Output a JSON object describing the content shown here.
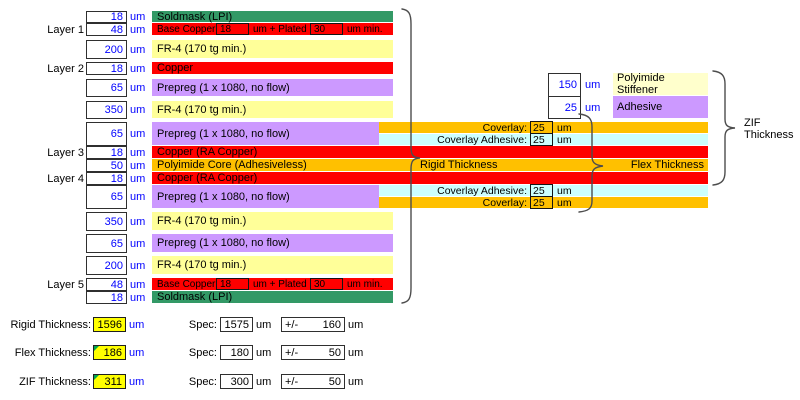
{
  "colors": {
    "soldmask": "#339966",
    "copper": "#FF0000",
    "fr4": "#FFFF99",
    "prepreg": "#CC99FF",
    "coverlay": "#FFC000",
    "coverlay_adhesive": "#CCFFFF",
    "core": "#FFC000",
    "stiffener": "#FFFFCC",
    "stiffener_adhesive": "#CC99FF",
    "result": "#FFFF00",
    "value_text": "#0000FF"
  },
  "stack": {
    "rows": [
      {
        "layer": "",
        "thickness": "18",
        "unit": "um",
        "material": "Soldmask (LPI)"
      },
      {
        "layer": "Layer 1",
        "thickness": "48",
        "unit": "um",
        "copper": {
          "prefix": "Base Copper",
          "base": "18",
          "mid": "um + Plated",
          "plated": "30",
          "suffix": "um min."
        }
      },
      {
        "layer": "",
        "thickness": "200",
        "unit": "um",
        "material": "FR-4 (170 tg min.)"
      },
      {
        "layer": "Layer 2",
        "thickness": "18",
        "unit": "um",
        "material": "Copper"
      },
      {
        "layer": "",
        "thickness": "65",
        "unit": "um",
        "material": "Prepreg (1 x 1080, no flow)"
      },
      {
        "layer": "",
        "thickness": "350",
        "unit": "um",
        "material": "FR-4 (170 tg min.)"
      },
      {
        "layer": "",
        "thickness": "65",
        "unit": "um",
        "material": "Prepreg (1 x 1080, no flow)"
      },
      {
        "layer": "Layer 3",
        "thickness": "18",
        "unit": "um",
        "material": "Copper (RA Copper)"
      },
      {
        "layer": "",
        "thickness": "50",
        "unit": "um",
        "material": "Polyimide Core (Adhesiveless)"
      },
      {
        "layer": "Layer 4",
        "thickness": "18",
        "unit": "um",
        "material": "Copper (RA Copper)"
      },
      {
        "layer": "",
        "thickness": "65",
        "unit": "um",
        "material": "Prepreg (1 x 1080, no flow)"
      },
      {
        "layer": "",
        "thickness": "350",
        "unit": "um",
        "material": "FR-4 (170 tg min.)"
      },
      {
        "layer": "",
        "thickness": "65",
        "unit": "um",
        "material": "Prepreg (1 x 1080, no flow)"
      },
      {
        "layer": "",
        "thickness": "200",
        "unit": "um",
        "material": "FR-4 (170 tg min.)"
      },
      {
        "layer": "Layer 5",
        "thickness": "48",
        "unit": "um",
        "copper": {
          "prefix": "Base Copper",
          "base": "18",
          "mid": "um + Plated",
          "plated": "30",
          "suffix": "um min."
        }
      },
      {
        "layer": "",
        "thickness": "18",
        "unit": "um",
        "material": "Soldmask (LPI)"
      }
    ]
  },
  "flex": {
    "coverlay_top": {
      "label": "Coverlay:",
      "value": "25",
      "unit": "um"
    },
    "adhesive_top": {
      "label": "Coverlay Adhesive:",
      "value": "25",
      "unit": "um"
    },
    "adhesive_bottom": {
      "label": "Coverlay Adhesive:",
      "value": "25",
      "unit": "um"
    },
    "coverlay_bottom": {
      "label": "Coverlay:",
      "value": "25",
      "unit": "um"
    },
    "rigid_label": "Rigid Thickness",
    "flex_label": "Flex Thickness"
  },
  "stiffener": {
    "stiffener_row": {
      "value": "150",
      "unit": "um",
      "material": "Polyimide Stiffener"
    },
    "adhesive_row": {
      "value": "25",
      "unit": "um",
      "material": "Adhesive"
    }
  },
  "zif": {
    "line1": "ZIF",
    "line2": "Thickness"
  },
  "summary": {
    "rows": [
      {
        "label": "Rigid Thickness:",
        "value": "1596",
        "unit": "um",
        "spec_label": "Spec:",
        "spec_value": "1575",
        "spec_unit": "um",
        "tol_label": "+/-",
        "tol_value": "160",
        "tol_unit": "um"
      },
      {
        "label": "Flex Thickness:",
        "value": "186",
        "unit": "um",
        "spec_label": "Spec:",
        "spec_value": "180",
        "spec_unit": "um",
        "tol_label": "+/-",
        "tol_value": "50",
        "tol_unit": "um"
      },
      {
        "label": "ZIF Thickness:",
        "value": "311",
        "unit": "um",
        "spec_label": "Spec:",
        "spec_value": "300",
        "spec_unit": "um",
        "tol_label": "+/-",
        "tol_value": "50",
        "tol_unit": "um"
      }
    ]
  }
}
